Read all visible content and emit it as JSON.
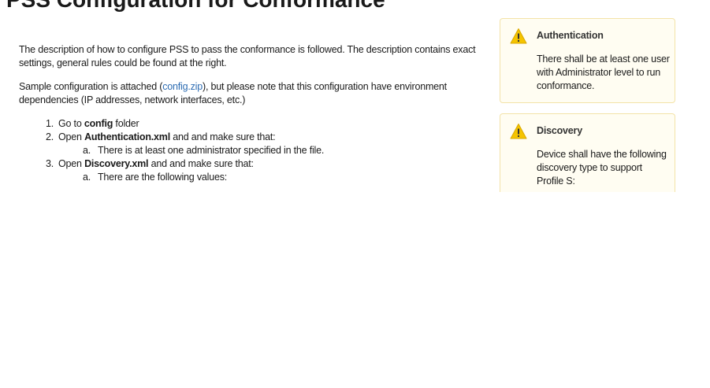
{
  "page": {
    "title": "PSS Configuration for Conformance"
  },
  "intro": {
    "paragraph1": "The description of how to configure PSS to pass the conformance is followed. The description contains exact settings, general rules could be found at the right.",
    "paragraph2_before": "Sample configuration is attached (",
    "paragraph2_link": "config.zip",
    "paragraph2_after": "), but please note that this configuration have environment dependencies (IP addresses, network interfaces, etc.)"
  },
  "steps": [
    {
      "number": "1.",
      "before": "Go to ",
      "bold": "config",
      "after": " folder",
      "substeps": []
    },
    {
      "number": "2.",
      "before": "Open ",
      "bold": "Authentication.xml",
      "after": " and and make sure that:",
      "substeps": [
        {
          "number": "a.",
          "text": "There is at least one administrator specified in the file."
        }
      ]
    },
    {
      "number": "3.",
      "before": "Open ",
      "bold": "Discovery.xml",
      "after": " and and make sure that:",
      "substeps": [
        {
          "number": "a.",
          "text": "There are the following values:"
        }
      ]
    }
  ],
  "sidebar": {
    "panels": [
      {
        "title": "Authentication",
        "body": "There shall be at least one user with Administrator level to run conformance.",
        "icon": "warning-icon"
      },
      {
        "title": "Discovery",
        "body": "Device shall have the following discovery type to support Profile S:",
        "icon": "warning-icon"
      }
    ]
  },
  "colors": {
    "link": "#2e6db3",
    "panel_background": "#fffdf2",
    "panel_border": "#f3e3a8",
    "warning_fill": "#f5c400"
  }
}
